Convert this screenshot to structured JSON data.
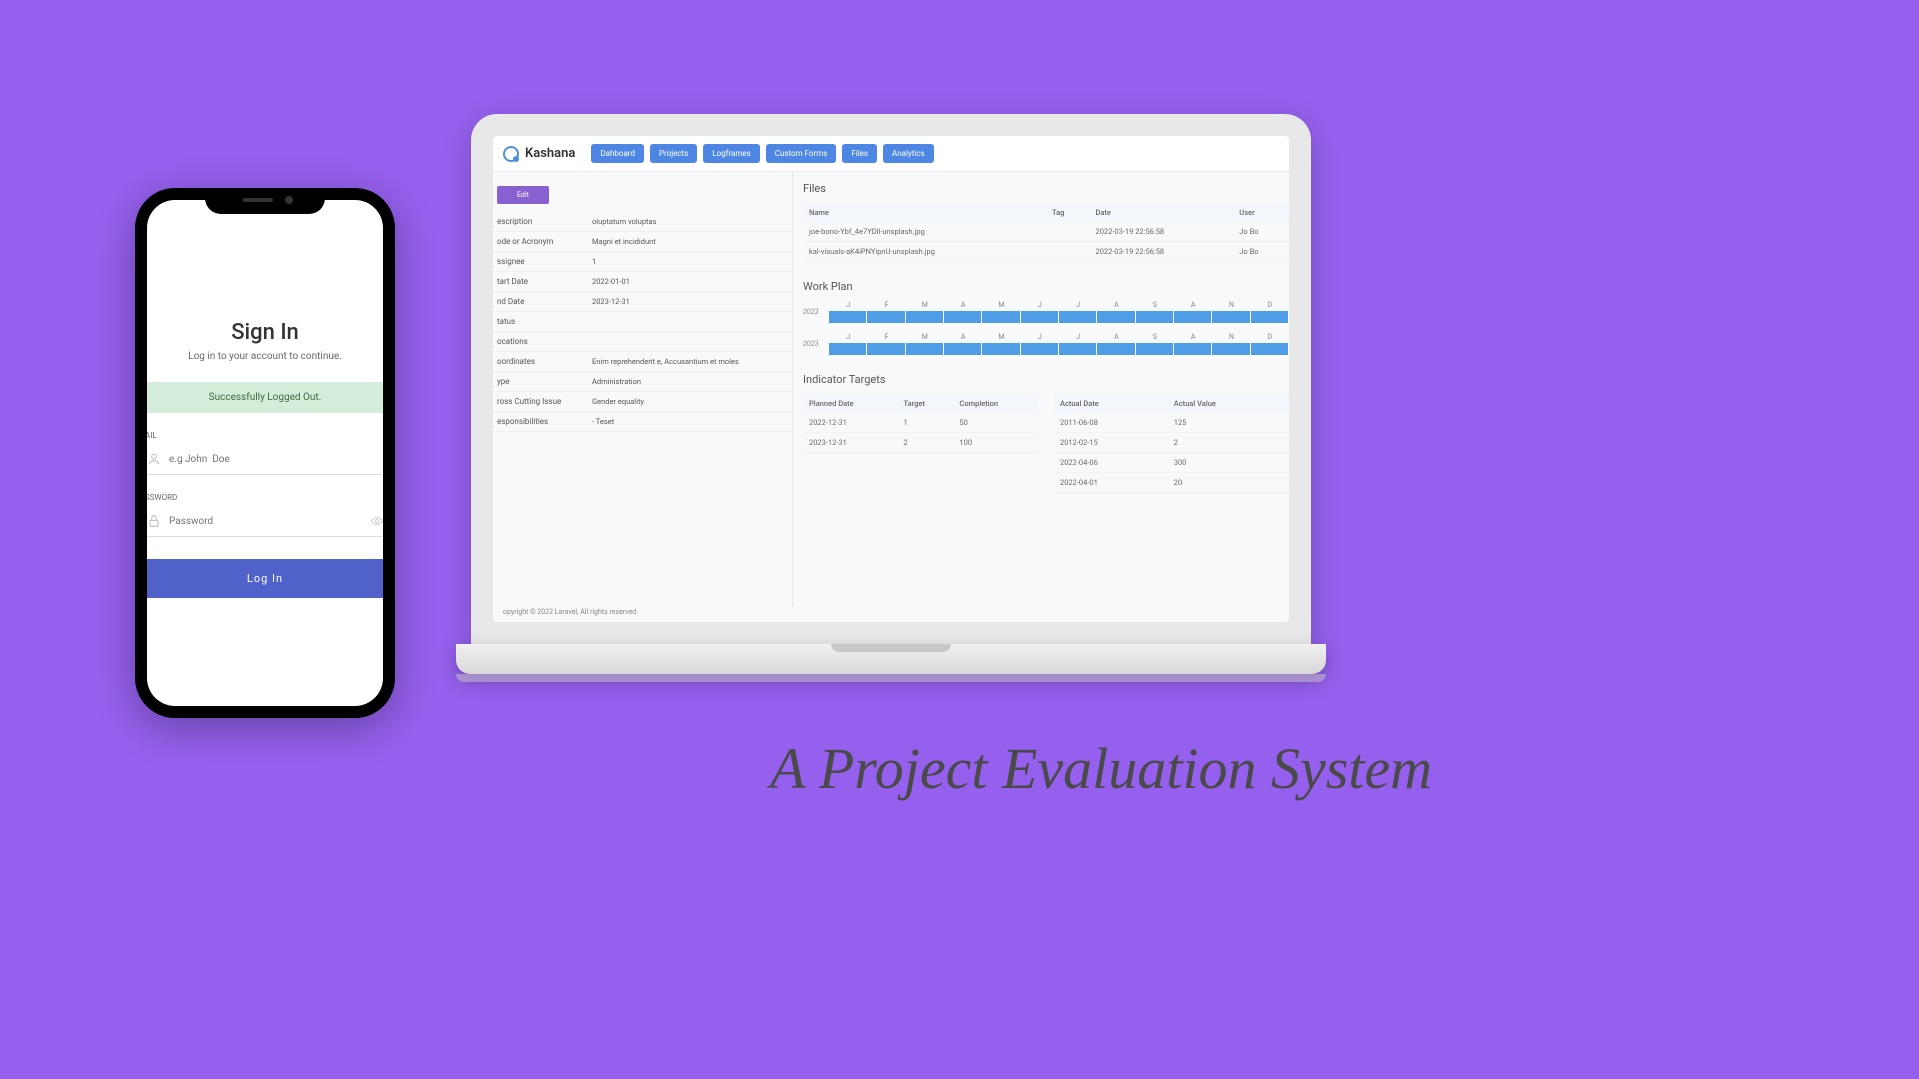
{
  "phone": {
    "title": "Sign In",
    "subtitle": "Log in to your account to continue.",
    "success_msg": "Successfully Logged Out.",
    "email_label": "AIL",
    "email_placeholder": "e.g John  Doe",
    "password_label": "SSWORD",
    "password_placeholder": "Password",
    "login_label": "Log In"
  },
  "laptop": {
    "app_name": "Kashana",
    "nav": [
      "Dahboard",
      "Projects",
      "Logframes",
      "Custom Forms",
      "Files",
      "Analytics"
    ],
    "edit_label": "Edit",
    "details": [
      {
        "key": "escription",
        "val": "oluptatum voluptas"
      },
      {
        "key": "ode or Acronym",
        "val": "Magni et incididunt"
      },
      {
        "key": "ssignee",
        "val": "1"
      },
      {
        "key": "tart Date",
        "val": "2022-01-01"
      },
      {
        "key": "nd Date",
        "val": "2023-12-31"
      },
      {
        "key": "tatus",
        "val": ""
      },
      {
        "key": "ocations",
        "val": ""
      },
      {
        "key": "oordinates",
        "val": "Enim reprehenderit e, Accusantium et moles"
      },
      {
        "key": "ype",
        "val": "Administration"
      },
      {
        "key": "ross Cutting Issue",
        "val": "Gender equality"
      },
      {
        "key": "esponsibilities",
        "val": "- Teset"
      }
    ],
    "files": {
      "title": "Files",
      "headers": [
        "Name",
        "Tag",
        "Date",
        "User"
      ],
      "rows": [
        {
          "name": "joe-bono-Ybf_4e7YDll-unsplash.jpg",
          "tag": "",
          "date": "2022-03-19 22:56:58",
          "user": "Jo Bo"
        },
        {
          "name": "kal-visuals-aK4iPNYipnU-unsplash.jpg",
          "tag": "",
          "date": "2022-03-19 22:56:58",
          "user": "Jo Bo"
        }
      ]
    },
    "workplan": {
      "title": "Work Plan",
      "months": [
        "J",
        "F",
        "M",
        "A",
        "M",
        "J",
        "J",
        "A",
        "S",
        "A",
        "N",
        "D"
      ],
      "years": [
        "2022",
        "2023"
      ]
    },
    "targets": {
      "title": "Indicator Targets",
      "planned": {
        "headers": [
          "Planned Date",
          "Target",
          "Completion"
        ],
        "rows": [
          {
            "date": "2022-12-31",
            "target": "1",
            "completion": "50"
          },
          {
            "date": "2023-12-31",
            "target": "2",
            "completion": "100"
          }
        ]
      },
      "actual": {
        "headers": [
          "Actual Date",
          "Actual Value"
        ],
        "rows": [
          {
            "date": "2011-06-08",
            "value": "125"
          },
          {
            "date": "2012-02-15",
            "value": "2"
          },
          {
            "date": "2022-04-06",
            "value": "300"
          },
          {
            "date": "2022-04-01",
            "value": "20"
          }
        ]
      }
    },
    "footer": "opyright © 2022 Laravel, All rights reserved."
  },
  "tagline": "A Project Evaluation System"
}
